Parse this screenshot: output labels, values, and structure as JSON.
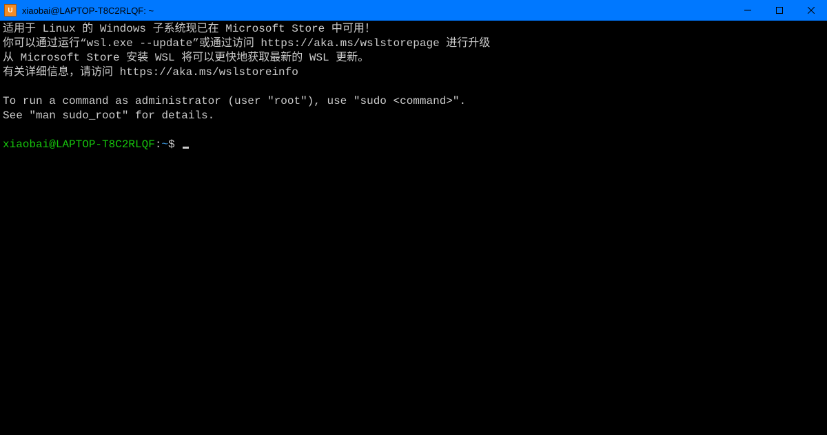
{
  "titlebar": {
    "icon_label": "U",
    "title": "xiaobai@LAPTOP-T8C2RLQF: ~"
  },
  "terminal": {
    "line1": "适用于 Linux 的 Windows 子系统现已在 Microsoft Store 中可用！",
    "line2": "你可以通过运行“wsl.exe --update”或通过访问 https://aka.ms/wslstorepage 进行升级",
    "line3": "从 Microsoft Store 安装 WSL 将可以更快地获取最新的 WSL 更新。",
    "line4": "有关详细信息，请访问 https://aka.ms/wslstoreinfo",
    "line5": "",
    "line6": "To run a command as administrator (user \"root\"), use \"sudo <command>\".",
    "line7": "See \"man sudo_root\" for details.",
    "line8": "",
    "prompt_user": "xiaobai@LAPTOP-T8C2RLQF",
    "prompt_sep": ":",
    "prompt_path": "~",
    "prompt_symbol": "$ "
  }
}
